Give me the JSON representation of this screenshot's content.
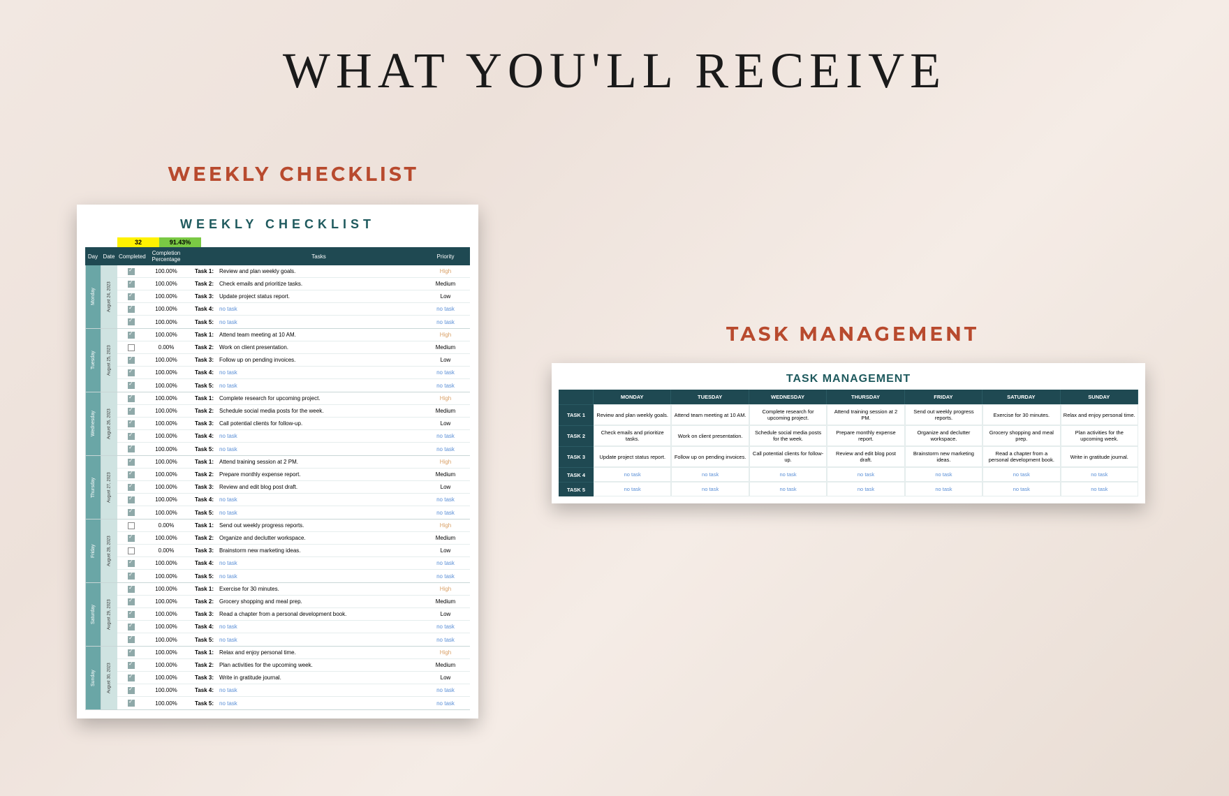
{
  "page": {
    "title": "WHAT YOU'LL RECEIVE",
    "labels": {
      "weekly": "WEEKLY CHECKLIST",
      "task": "TASK MANAGEMENT"
    }
  },
  "weekly": {
    "title": "WEEKLY CHECKLIST",
    "count": "32",
    "percent": "91.43%",
    "columns": {
      "day": "Day",
      "date": "Date",
      "completed": "Completed",
      "completion_pct": "Completion Percentage",
      "tasks": "Tasks",
      "priority": "Priority"
    },
    "notask_text": "no task",
    "days": [
      {
        "name": "Monday",
        "date": "August 24, 2023",
        "rows": [
          {
            "checked": true,
            "pct": "100.00%",
            "label": "Task 1:",
            "text": "Review and plan weekly goals.",
            "priority": "High"
          },
          {
            "checked": true,
            "pct": "100.00%",
            "label": "Task 2:",
            "text": "Check emails and prioritize tasks.",
            "priority": "Medium"
          },
          {
            "checked": true,
            "pct": "100.00%",
            "label": "Task 3:",
            "text": "Update project status report.",
            "priority": "Low"
          },
          {
            "checked": true,
            "pct": "100.00%",
            "label": "Task 4:",
            "text": "no task",
            "priority": "no task"
          },
          {
            "checked": true,
            "pct": "100.00%",
            "label": "Task 5:",
            "text": "no task",
            "priority": "no task"
          }
        ]
      },
      {
        "name": "Tuesday",
        "date": "August 25, 2023",
        "rows": [
          {
            "checked": true,
            "pct": "100.00%",
            "label": "Task 1:",
            "text": "Attend team meeting at 10 AM.",
            "priority": "High"
          },
          {
            "checked": false,
            "pct": "0.00%",
            "label": "Task 2:",
            "text": "Work on client presentation.",
            "priority": "Medium"
          },
          {
            "checked": true,
            "pct": "100.00%",
            "label": "Task 3:",
            "text": "Follow up on pending invoices.",
            "priority": "Low"
          },
          {
            "checked": true,
            "pct": "100.00%",
            "label": "Task 4:",
            "text": "no task",
            "priority": "no task"
          },
          {
            "checked": true,
            "pct": "100.00%",
            "label": "Task 5:",
            "text": "no task",
            "priority": "no task"
          }
        ]
      },
      {
        "name": "Wednesday",
        "date": "August 26, 2023",
        "rows": [
          {
            "checked": true,
            "pct": "100.00%",
            "label": "Task 1:",
            "text": "Complete research for upcoming project.",
            "priority": "High"
          },
          {
            "checked": true,
            "pct": "100.00%",
            "label": "Task 2:",
            "text": "Schedule social media posts for the week.",
            "priority": "Medium"
          },
          {
            "checked": true,
            "pct": "100.00%",
            "label": "Task 3:",
            "text": "Call potential clients for follow-up.",
            "priority": "Low"
          },
          {
            "checked": true,
            "pct": "100.00%",
            "label": "Task 4:",
            "text": "no task",
            "priority": "no task"
          },
          {
            "checked": true,
            "pct": "100.00%",
            "label": "Task 5:",
            "text": "no task",
            "priority": "no task"
          }
        ]
      },
      {
        "name": "Thursday",
        "date": "August 27, 2023",
        "rows": [
          {
            "checked": true,
            "pct": "100.00%",
            "label": "Task 1:",
            "text": "Attend training session at 2 PM.",
            "priority": "High"
          },
          {
            "checked": true,
            "pct": "100.00%",
            "label": "Task 2:",
            "text": "Prepare monthly expense report.",
            "priority": "Medium"
          },
          {
            "checked": true,
            "pct": "100.00%",
            "label": "Task 3:",
            "text": "Review and edit blog post draft.",
            "priority": "Low"
          },
          {
            "checked": true,
            "pct": "100.00%",
            "label": "Task 4:",
            "text": "no task",
            "priority": "no task"
          },
          {
            "checked": true,
            "pct": "100.00%",
            "label": "Task 5:",
            "text": "no task",
            "priority": "no task"
          }
        ]
      },
      {
        "name": "Friday",
        "date": "August 28, 2023",
        "rows": [
          {
            "checked": false,
            "pct": "0.00%",
            "label": "Task 1:",
            "text": "Send out weekly progress reports.",
            "priority": "High"
          },
          {
            "checked": true,
            "pct": "100.00%",
            "label": "Task 2:",
            "text": "Organize and declutter workspace.",
            "priority": "Medium"
          },
          {
            "checked": false,
            "pct": "0.00%",
            "label": "Task 3:",
            "text": "Brainstorm new marketing ideas.",
            "priority": "Low"
          },
          {
            "checked": true,
            "pct": "100.00%",
            "label": "Task 4:",
            "text": "no task",
            "priority": "no task"
          },
          {
            "checked": true,
            "pct": "100.00%",
            "label": "Task 5:",
            "text": "no task",
            "priority": "no task"
          }
        ]
      },
      {
        "name": "Saturday",
        "date": "August 29, 2023",
        "rows": [
          {
            "checked": true,
            "pct": "100.00%",
            "label": "Task 1:",
            "text": "Exercise for 30 minutes.",
            "priority": "High"
          },
          {
            "checked": true,
            "pct": "100.00%",
            "label": "Task 2:",
            "text": "Grocery shopping and meal prep.",
            "priority": "Medium"
          },
          {
            "checked": true,
            "pct": "100.00%",
            "label": "Task 3:",
            "text": "Read a chapter from a personal development book.",
            "priority": "Low"
          },
          {
            "checked": true,
            "pct": "100.00%",
            "label": "Task 4:",
            "text": "no task",
            "priority": "no task"
          },
          {
            "checked": true,
            "pct": "100.00%",
            "label": "Task 5:",
            "text": "no task",
            "priority": "no task"
          }
        ]
      },
      {
        "name": "Sunday",
        "date": "August 30, 2023",
        "rows": [
          {
            "checked": true,
            "pct": "100.00%",
            "label": "Task 1:",
            "text": "Relax and enjoy personal time.",
            "priority": "High"
          },
          {
            "checked": true,
            "pct": "100.00%",
            "label": "Task 2:",
            "text": "Plan activities for the upcoming week.",
            "priority": "Medium"
          },
          {
            "checked": true,
            "pct": "100.00%",
            "label": "Task 3:",
            "text": "Write in gratitude journal.",
            "priority": "Low"
          },
          {
            "checked": true,
            "pct": "100.00%",
            "label": "Task 4:",
            "text": "no task",
            "priority": "no task"
          },
          {
            "checked": true,
            "pct": "100.00%",
            "label": "Task 5:",
            "text": "no task",
            "priority": "no task"
          }
        ]
      }
    ]
  },
  "taskmgmt": {
    "title": "TASK MANAGEMENT",
    "days": [
      "MONDAY",
      "TUESDAY",
      "WEDNESDAY",
      "THURSDAY",
      "FRIDAY",
      "SATURDAY",
      "SUNDAY"
    ],
    "rows": [
      {
        "label": "TASK 1",
        "cells": [
          "Review and plan weekly goals.",
          "Attend team meeting at 10 AM.",
          "Complete research for upcoming project.",
          "Attend training session at 2 PM.",
          "Send out weekly progress reports.",
          "Exercise for 30 minutes.",
          "Relax and enjoy personal time."
        ]
      },
      {
        "label": "TASK 2",
        "cells": [
          "Check emails and prioritize tasks.",
          "Work on client presentation.",
          "Schedule social media posts for the week.",
          "Prepare monthly expense report.",
          "Organize and declutter workspace.",
          "Grocery shopping and meal prep.",
          "Plan activities for the upcoming week."
        ]
      },
      {
        "label": "TASK 3",
        "cells": [
          "Update project status report.",
          "Follow up on pending invoices.",
          "Call potential clients for follow-up.",
          "Review and edit blog post draft.",
          "Brainstorm new marketing ideas.",
          "Read a chapter from a personal development book.",
          "Write in gratitude journal."
        ]
      },
      {
        "label": "TASK 4",
        "cells": [
          "no task",
          "no task",
          "no task",
          "no task",
          "no task",
          "no task",
          "no task"
        ]
      },
      {
        "label": "TASK 5",
        "cells": [
          "no task",
          "no task",
          "no task",
          "no task",
          "no task",
          "no task",
          "no task"
        ]
      }
    ]
  }
}
